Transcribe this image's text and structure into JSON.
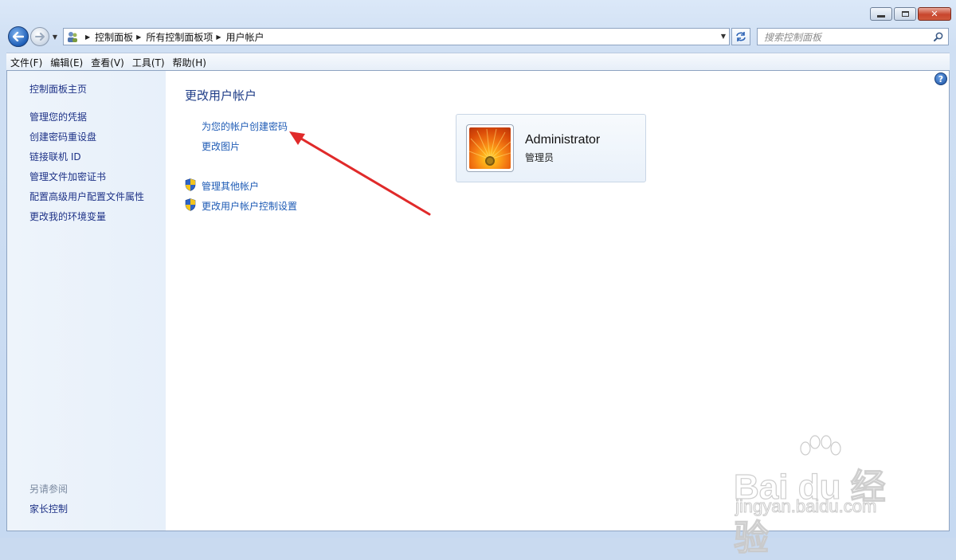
{
  "window": {
    "caption_buttons": [
      "minimize",
      "maximize",
      "close"
    ]
  },
  "navigation": {
    "breadcrumb": [
      "控制面板",
      "所有控制面板项",
      "用户帐户"
    ],
    "search_placeholder": "搜索控制面板"
  },
  "menu": [
    "文件(F)",
    "编辑(E)",
    "查看(V)",
    "工具(T)",
    "帮助(H)"
  ],
  "sidebar": {
    "home": "控制面板主页",
    "links": [
      "管理您的凭据",
      "创建密码重设盘",
      "链接联机 ID",
      "管理文件加密证书",
      "配置高级用户配置文件属性",
      "更改我的环境变量"
    ],
    "see_also_label": "另请参阅",
    "see_also_links": [
      "家长控制"
    ]
  },
  "main": {
    "title": "更改用户帐户",
    "tasks": [
      "为您的帐户创建密码",
      "更改图片"
    ],
    "admin_tasks": [
      "管理其他帐户",
      "更改用户帐户控制设置"
    ]
  },
  "account": {
    "name": "Administrator",
    "role": "管理员"
  },
  "watermark": {
    "brand": "Bai du 经验",
    "url": "jingyan.baidu.com"
  },
  "colors": {
    "link": "#1e5bb5",
    "heading": "#1e3c87",
    "annotation_arrow": "#e02a2a"
  }
}
